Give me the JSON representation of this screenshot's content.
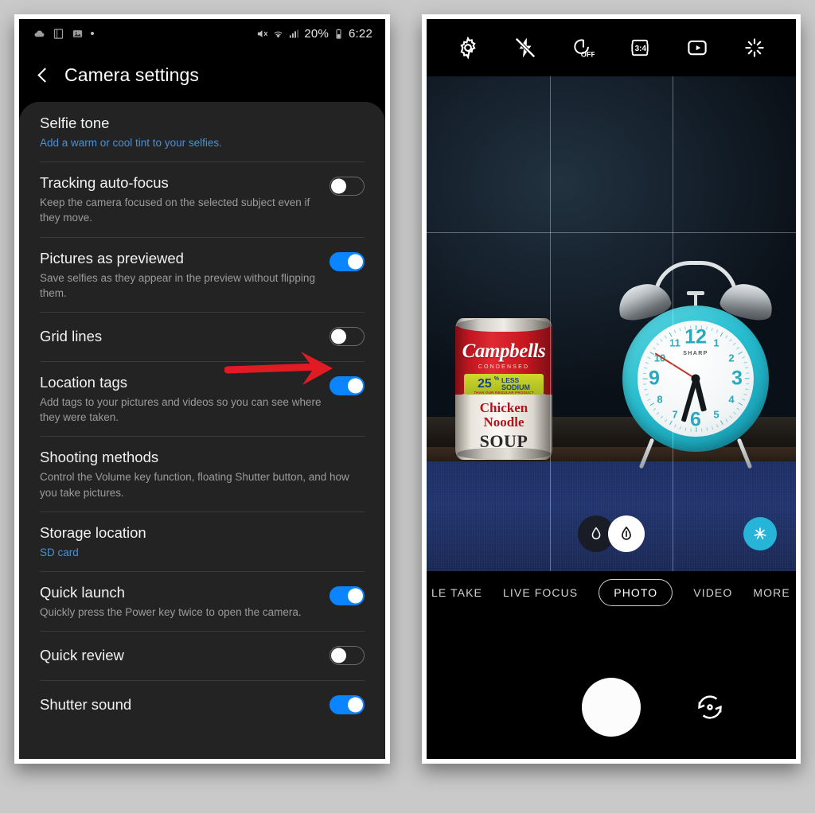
{
  "page": {
    "background_color": "#c9c9c9",
    "accent_blue": "#0a84ff",
    "link_blue": "#4a90d9",
    "annotation_color": "#e01b24"
  },
  "settings_phone": {
    "status_bar": {
      "left_icons": [
        "cloud-icon",
        "document-app-icon",
        "gallery-icon",
        "dot-indicator"
      ],
      "right_icons": [
        "mute-icon",
        "wifi-icon",
        "signal-icon",
        "battery-icon"
      ],
      "battery_percent": "20%",
      "time": "6:22"
    },
    "header": {
      "back_label": "Back",
      "title": "Camera settings"
    },
    "items": [
      {
        "name": "selfie-tone",
        "title": "Selfie tone",
        "subtitle": "Add a warm or cool tint to your selfies.",
        "subtitle_style": "link",
        "control": "none"
      },
      {
        "name": "tracking-auto-focus",
        "title": "Tracking auto-focus",
        "subtitle": "Keep the camera focused on the selected subject even if they move.",
        "subtitle_style": "muted",
        "control": "toggle",
        "toggle_state": "off"
      },
      {
        "name": "pictures-as-previewed",
        "title": "Pictures as previewed",
        "subtitle": "Save selfies as they appear in the preview without flipping them.",
        "subtitle_style": "muted",
        "control": "toggle",
        "toggle_state": "on"
      },
      {
        "name": "grid-lines",
        "title": "Grid lines",
        "subtitle": "",
        "subtitle_style": "none",
        "control": "toggle",
        "toggle_state": "off",
        "annotated": true
      },
      {
        "name": "location-tags",
        "title": "Location tags",
        "subtitle": "Add tags to your pictures and videos so you can see where they were taken.",
        "subtitle_style": "muted",
        "control": "toggle",
        "toggle_state": "on"
      },
      {
        "name": "shooting-methods",
        "title": "Shooting methods",
        "subtitle": "Control the Volume key function, floating Shutter button, and how you take pictures.",
        "subtitle_style": "muted",
        "control": "none"
      },
      {
        "name": "storage-location",
        "title": "Storage location",
        "subtitle": "SD card",
        "subtitle_style": "link",
        "control": "none"
      },
      {
        "name": "quick-launch",
        "title": "Quick launch",
        "subtitle": "Quickly press the Power key twice to open the camera.",
        "subtitle_style": "muted",
        "control": "toggle",
        "toggle_state": "on"
      },
      {
        "name": "quick-review",
        "title": "Quick review",
        "subtitle": "",
        "subtitle_style": "none",
        "control": "toggle",
        "toggle_state": "off"
      },
      {
        "name": "shutter-sound",
        "title": "Shutter sound",
        "subtitle": "",
        "subtitle_style": "none",
        "control": "toggle",
        "toggle_state": "on"
      }
    ],
    "annotation": {
      "type": "arrow",
      "points_to": "grid-lines-toggle",
      "direction": "right"
    }
  },
  "camera_phone": {
    "toolbar": [
      {
        "name": "settings-gear-icon",
        "label": "Settings"
      },
      {
        "name": "flash-off-icon",
        "label": "Flash off"
      },
      {
        "name": "timer-off-icon",
        "label": "OFF"
      },
      {
        "name": "aspect-ratio-icon",
        "label": "3:4"
      },
      {
        "name": "motion-photo-icon",
        "label": "Motion photo"
      },
      {
        "name": "effects-icon",
        "label": "Effects"
      }
    ],
    "viewfinder": {
      "grid_overlay": true,
      "grid_type": "rule-of-thirds",
      "subjects": [
        {
          "name": "soup-can",
          "brand": "Campbells",
          "condensed_label": "CONDENSED",
          "badge_number": "25",
          "badge_percent": "%",
          "badge_less": "LESS",
          "badge_sodium": "SODIUM",
          "badge_fine_print": "THAN OUR REGULAR PRODUCT",
          "product_line1": "Chicken",
          "product_line2": "Noodle",
          "product_line3": "SOUP"
        },
        {
          "name": "alarm-clock",
          "brand": "SHARP",
          "color": "#27bdd0",
          "numbers": [
            "12",
            "1",
            "2",
            "3",
            "4",
            "5",
            "6",
            "7",
            "8",
            "9",
            "10",
            "11"
          ],
          "time_shown": "5:32"
        }
      ]
    },
    "lens_selector": {
      "inactive_label": "Wide lens",
      "active_label": "Standard lens"
    },
    "effects_button": {
      "name": "scene-optimizer-button",
      "label": "Scene optimizer"
    },
    "modes": [
      {
        "label": "LE TAKE",
        "selected": false
      },
      {
        "label": "LIVE FOCUS",
        "selected": false
      },
      {
        "label": "PHOTO",
        "selected": true
      },
      {
        "label": "VIDEO",
        "selected": false
      },
      {
        "label": "MORE",
        "selected": false
      }
    ],
    "shutter": {
      "label": "Shutter"
    },
    "flip": {
      "label": "Switch camera"
    }
  }
}
